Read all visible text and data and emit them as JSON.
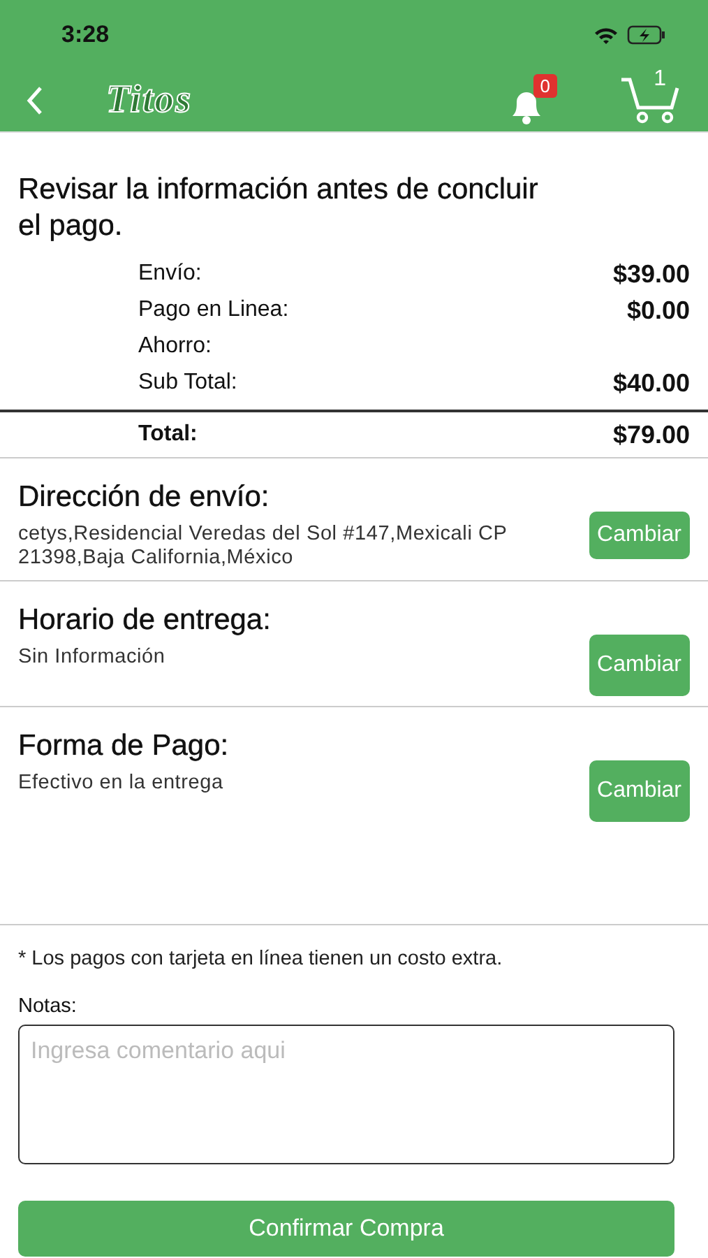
{
  "status_bar": {
    "time": "3:28"
  },
  "nav": {
    "logo": "Titos",
    "notifications": "0",
    "cart_count": "1"
  },
  "review": {
    "title": "Revisar la información antes de concluir el pago.",
    "lines": [
      {
        "label": "Envío:",
        "value": "$39.00"
      },
      {
        "label": "Pago en Linea:",
        "value": "$0.00"
      },
      {
        "label": "Ahorro:"
      },
      {
        "label": "Sub Total:",
        "value": "$40.00"
      }
    ],
    "total": {
      "label": "Total:",
      "value": "$79.00"
    }
  },
  "sections": [
    {
      "title": "Dirección de envío:",
      "text": "cetys,Residencial Veredas del Sol #147,Mexicali CP 21398,Baja California,México",
      "button": "Cambiar"
    },
    {
      "title": "Horario de entrega:",
      "text": "Sin Información",
      "button": "Cambiar"
    },
    {
      "title": "Forma de Pago:",
      "text": "Efectivo en la entrega",
      "button": "Cambiar"
    }
  ],
  "note": "* Los pagos con tarjeta en línea tienen un costo extra.",
  "notes": {
    "label": "Notas:",
    "placeholder": "Ingresa comentario aqui"
  },
  "confirm_button": "Confirmar Compra"
}
